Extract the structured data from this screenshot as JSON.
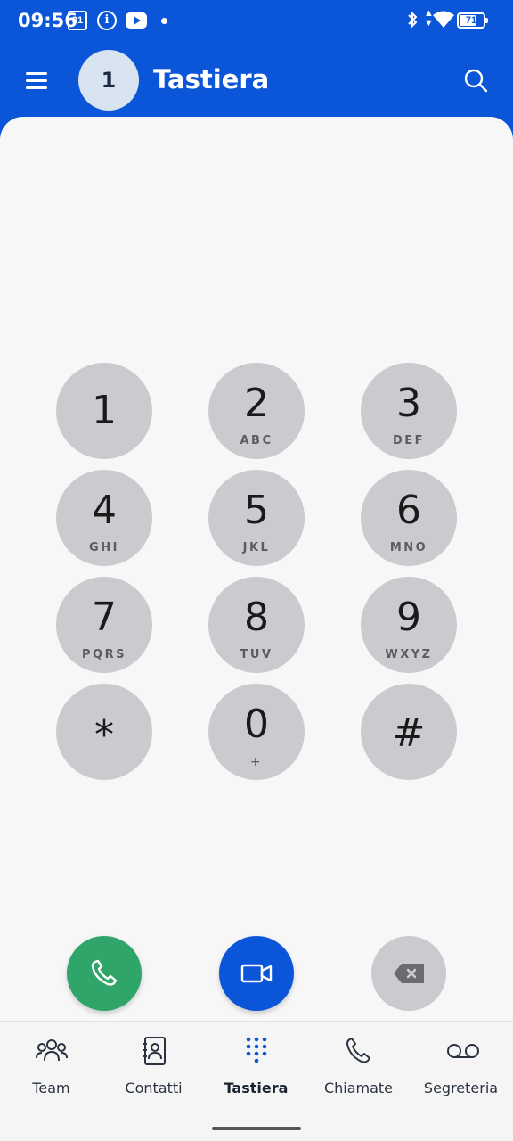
{
  "status_bar": {
    "time": "09:56",
    "calendar_day": "31",
    "battery_level": "71",
    "battery_percent": 71
  },
  "app_bar": {
    "avatar_initial": "1",
    "title": "Tastiera"
  },
  "keypad": {
    "keys": [
      {
        "digit": "1",
        "letters": ""
      },
      {
        "digit": "2",
        "letters": "ABC"
      },
      {
        "digit": "3",
        "letters": "DEF"
      },
      {
        "digit": "4",
        "letters": "GHI"
      },
      {
        "digit": "5",
        "letters": "JKL"
      },
      {
        "digit": "6",
        "letters": "MNO"
      },
      {
        "digit": "7",
        "letters": "PQRS"
      },
      {
        "digit": "8",
        "letters": "TUV"
      },
      {
        "digit": "9",
        "letters": "WXYZ"
      },
      {
        "digit": "*",
        "letters": ""
      },
      {
        "digit": "0",
        "letters": "+"
      },
      {
        "digit": "#",
        "letters": ""
      }
    ]
  },
  "actions": {
    "call_icon": "phone-icon",
    "video_icon": "video-camera-icon",
    "delete_icon": "backspace-icon"
  },
  "bottom_nav": {
    "items": [
      {
        "label": "Team",
        "icon": "team-icon"
      },
      {
        "label": "Contatti",
        "icon": "contacts-icon"
      },
      {
        "label": "Tastiera",
        "icon": "dialpad-icon",
        "active": true
      },
      {
        "label": "Chiamate",
        "icon": "phone-icon"
      },
      {
        "label": "Segreteria",
        "icon": "voicemail-icon"
      }
    ]
  },
  "colors": {
    "brand_blue": "#0a55d8",
    "call_green": "#2fa56a",
    "key_gray": "#cbcacf"
  }
}
